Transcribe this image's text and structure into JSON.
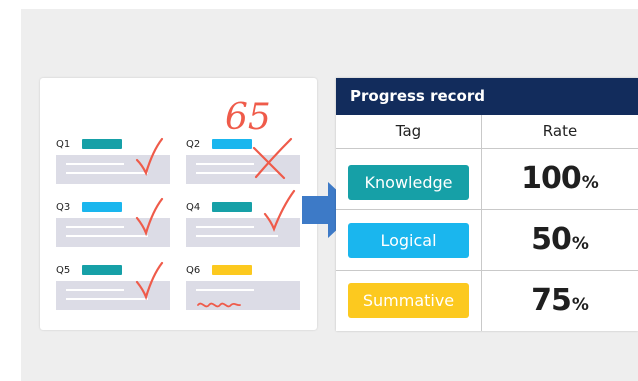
{
  "worksheet": {
    "score": "65",
    "questions": [
      {
        "label": "Q1",
        "tag_color": "#16a0a7",
        "mark": "check"
      },
      {
        "label": "Q2",
        "tag_color": "#1ab6ee",
        "mark": "cross"
      },
      {
        "label": "Q3",
        "tag_color": "#1ab6ee",
        "mark": "check"
      },
      {
        "label": "Q4",
        "tag_color": "#16a0a7",
        "mark": "check"
      },
      {
        "label": "Q5",
        "tag_color": "#16a0a7",
        "mark": "check"
      },
      {
        "label": "Q6",
        "tag_color": "#fcc91f",
        "mark": "squiggle"
      }
    ]
  },
  "table": {
    "title": "Progress record",
    "header_bg": "#122c5c",
    "columns": [
      "Tag",
      "Rate"
    ],
    "rows": [
      {
        "tag": "Knowledge",
        "color": "#16a0a7",
        "rate": "100",
        "unit": "%"
      },
      {
        "tag": "Logical",
        "color": "#1ab6ee",
        "rate": "50",
        "unit": "%"
      },
      {
        "tag": "Summative",
        "color": "#fcc91f",
        "rate": "75",
        "unit": "%"
      }
    ]
  },
  "colors": {
    "mark_red": "#ef5b4a",
    "arrow_blue": "#3d7ac7"
  },
  "icons": [
    "check-mark-icon",
    "cross-mark-icon",
    "squiggle-mark-icon",
    "arrow-right-icon"
  ]
}
